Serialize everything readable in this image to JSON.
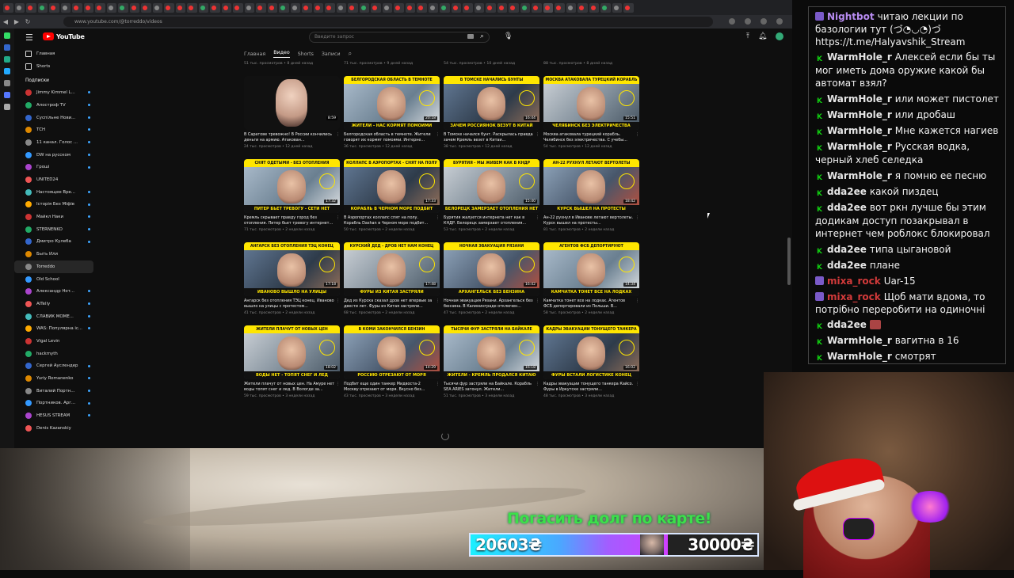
{
  "browser": {
    "url": "www.youtube.com/@torreddo/videos",
    "tab_count": 55
  },
  "youtube": {
    "logo": "YouTube",
    "search_placeholder": "Введите запрос",
    "nav": [
      {
        "label": "Главная"
      },
      {
        "label": "Shorts"
      }
    ],
    "subscriptions_header": "Подписки",
    "subscriptions": [
      {
        "label": "Jimmy Kimmel L...",
        "dot": true
      },
      {
        "label": "Апостроф TV",
        "dot": true
      },
      {
        "label": "Суспільне Нови...",
        "dot": true
      },
      {
        "label": "ТСН",
        "dot": true
      },
      {
        "label": "11 канал. Голос ...",
        "dot": true
      },
      {
        "label": "DW на русском",
        "dot": true
      },
      {
        "label": "Гроші",
        "dot": true
      },
      {
        "label": "UNITED24",
        "dot": false
      },
      {
        "label": "Настоящее Вре...",
        "dot": true
      },
      {
        "label": "Історія Без Міфів",
        "dot": true
      },
      {
        "label": "Майкл Наки",
        "dot": true
      },
      {
        "label": "STERNENKO",
        "dot": true
      },
      {
        "label": "Дмитро Кулеба",
        "dot": true
      },
      {
        "label": "Быть Или",
        "dot": false
      },
      {
        "label": "Torreddo",
        "dot": false,
        "selected": true
      },
      {
        "label": "Old School",
        "dot": false
      },
      {
        "label": "Александр Нот...",
        "dot": true
      },
      {
        "label": "AITelly",
        "dot": true
      },
      {
        "label": "СЛАВИК МОМЕ...",
        "dot": true
      },
      {
        "label": "WAS: Популярна іс...",
        "dot": true
      },
      {
        "label": "Vigal Levin",
        "dot": false
      },
      {
        "label": "hackmyth",
        "dot": false
      },
      {
        "label": "Сергей Ауслендер",
        "dot": true
      },
      {
        "label": "Yuriy Romanenko",
        "dot": true
      },
      {
        "label": "Виталий Портн...",
        "dot": true
      },
      {
        "label": "Портников. Арг...",
        "dot": true
      },
      {
        "label": "HESUS STREAM",
        "dot": true
      },
      {
        "label": "Denis Kazanskiy",
        "dot": false
      }
    ],
    "channel_tabs": [
      {
        "label": "Главная",
        "active": false
      },
      {
        "label": "Видео",
        "active": true
      },
      {
        "label": "Shorts",
        "active": false
      },
      {
        "label": "Записи",
        "active": false
      }
    ],
    "prev_row_meta": [
      "51 тыс. просмотров • 8 дней назад",
      "71 тыс. просмотров • 9 дней назад",
      "54 тыс. просмотров • 10 дней назад",
      "88 тыс. просмотров • 8 дней назад"
    ],
    "rows": [
      [
        {
          "banner": "",
          "caption": "",
          "duration": "8:59",
          "plain": true,
          "title": "В Саратове тревожно! В России кончились деньги на армию. Атакован...",
          "meta": "24 тыс. просмотров • 12 дней назад"
        },
        {
          "banner": "БЕЛГОРОДСКАЯ ОБЛАСТЬ В ТЕМНОТЕ",
          "caption": "ЖИТЕЛИ - НАС КОРМЯТ ПОМОИМИ",
          "duration": "20:18",
          "plain": false,
          "title": "Белгородская область в темноте. Жители говорят их кормят помоями. Интерне...",
          "meta": "36 тыс. просмотров • 12 дней назад"
        },
        {
          "banner": "В ТОМСКЕ НАЧАЛИСЬ БУНТЫ",
          "caption": "ЗАЧЕМ РОССИЯНОК ВЕЗУТ В КИТАЙ",
          "duration": "16:44",
          "plain": false,
          "title": "В Томске начался бунт. Раскрылась правда зачем Кремль везет в Китаи...",
          "meta": "38 тыс. просмотров • 12 дней назад"
        },
        {
          "banner": "МОСКВА АТАКОВАЛА ТУРЕЦКИЙ КОРАБЛЬ",
          "caption": "ЧЕЛЯБИНСК БЕЗ ЭЛЕКТРИЧЕСТВА",
          "duration": "15:51",
          "plain": false,
          "title": "Москва атаковала турецкий корабль. Челябинск без электричества. С учебы...",
          "meta": "54 тыс. просмотров • 12 дней назад"
        }
      ],
      [
        {
          "banner": "СНЯТ ОДЕТЫМИ - БЕЗ ОТОПЛЕНИЯ",
          "caption": "ПИТЕР БЬЕТ ТРЕВОГУ - СЕТИ НЕТ",
          "duration": "17:32",
          "plain": false,
          "title": "Кремль скрывает правду город без отопления. Питер бьет тревогу интернет...",
          "meta": "71 тыс. просмотров • 2 недели назад"
        },
        {
          "banner": "КОЛЛАПС В АЭРОПОРТАХ - СНЯТ НА ПОЛУ",
          "caption": "КОРАБЛЬ В ЧЕРНОМ МОРЕ ПОДБИТ",
          "duration": "17:33",
          "plain": false,
          "title": "В Аэропортах коллапс спят на полу. Корабль Dashan в Черном море подбит...",
          "meta": "50 тыс. просмотров • 2 недели назад"
        },
        {
          "banner": "БУРЯТИЯ - МЫ ЖИВЕМ КАК В КНДР",
          "caption": "БЕЛОРЕЦК ЗАМЕРЗАЕТ ОТОПЛЕНИЯ НЕТ",
          "duration": "15:40",
          "plain": false,
          "title": "Бурятия жалуется интернета нет как в КНДР. Белорецк замерзает отопления...",
          "meta": "53 тыс. просмотров • 2 недели назад"
        },
        {
          "banner": "АН-22 РУХНУЛ ЛЕТАЮТ ВЕРТОЛЕТЫ",
          "caption": "КУРСК ВЫШЕЛ НА ПРОТЕСТЫ",
          "duration": "18:42",
          "plain": false,
          "title": "Ан-22 рухнул в Иванове летают вертолеты. Курск вышел на протесты...",
          "meta": "81 тыс. просмотров • 2 недели назад"
        }
      ],
      [
        {
          "banner": "АНГАРСК БЕЗ ОТОПЛЕНИЯ ТЭЦ КОНЕЦ",
          "caption": "ИВАНОВО ВЫШЛО НА УЛИЦЫ",
          "duration": "17:18",
          "plain": false,
          "title": "Ангарск без отопления ТЭЦ конец. Иваново вышло на улицы с протестом...",
          "meta": "41 тыс. просмотров • 2 недели назад"
        },
        {
          "banner": "КУРСКИЙ ДЕД - ДРОВ НЕТ НАМ КОНЕЦ",
          "caption": "ФУРЫ ИЗ КИТАЯ ЗАСТРЯЛИ",
          "duration": "17:48",
          "plain": false,
          "title": "Дед из Курска сказал дров нет впервые за двести лет. Фуры из Китая застряли...",
          "meta": "68 тыс. просмотров • 2 недели назад"
        },
        {
          "banner": "НОЧНАЯ ЭВАКУАЦИЯ РЯЗАНИ",
          "caption": "АРХАНГЕЛЬСК БЕЗ БЕНЗИНА",
          "duration": "16:42",
          "plain": false,
          "title": "Ночная эвакуация Рязани. Архангельск без бензина. В Калининграде отключен...",
          "meta": "47 тыс. просмотров • 2 недели назад"
        },
        {
          "banner": "АГЕНТОВ ФСБ ДЕПОРТИРУЮТ",
          "caption": "КАМЧАТКА ТОНЕТ ВСЕ НА ЛОДКАХ",
          "duration": "14:34",
          "plain": false,
          "title": "Камчатка тонет все на лодках. Агентов ФСБ депортировали из Польши. В...",
          "meta": "58 тыс. просмотров • 2 недели назад"
        }
      ],
      [
        {
          "banner": "ЖИТЕЛИ ПЛАЧУТ ОТ НОВЫХ ЦЕН",
          "caption": "ВОДЫ НЕТ - ТОПЯТ СНЕГ И ЛЕД",
          "duration": "18:02",
          "plain": false,
          "title": "Жители плачут от новых цен. На Амуре нет воды топят снег и лед. В Вологде за...",
          "meta": "59 тыс. просмотров • 3 недели назад"
        },
        {
          "banner": "В КОМИ ЗАКОНЧИЛСЯ БЕНЗИН",
          "caption": "РОССИЮ ОТРЕЗАЮТ ОТ МОРЯ",
          "duration": "14:29",
          "plain": false,
          "title": "Подбит еще один танкер Мидвоста-2 Москву отрезают от моря. Вкусно без...",
          "meta": "43 тыс. просмотров • 3 недели назад"
        },
        {
          "banner": "ТЫСЯЧИ ФУР ЗАСТРЯЛИ НА БАЙКАЛЕ",
          "caption": "ЖИТЕЛИ - КРЕМЛЬ ПРОДАЛСЯ КИТАЮ",
          "duration": "16:18",
          "plain": false,
          "title": "Тысячи фур застряли на Байкале. Корабль SEA ARIES затонул. Жители...",
          "meta": "51 тыс. просмотров • 3 недели назад"
        },
        {
          "banner": "КАДРЫ ЭВАКУАЦИИ ТОНУЩЕГО ТАНКЕРА",
          "caption": "ФУРЫ ВСТАЛИ ЛОГИСТИКЕ КОНЕЦ",
          "duration": "16:02",
          "plain": false,
          "title": "Кадры эвакуации тонущего танкера Кайсо. Фуры в Иркутске застряли...",
          "meta": "48 тыс. просмотров • 3 недели назад"
        }
      ]
    ]
  },
  "chat": [
    {
      "badge": "",
      "user": "Nightbot",
      "text": "читаю лекции по базологии тут (づ◔◡◔)づ https://t.me/Halyavshik_Stream",
      "color": "#b78bf0"
    },
    {
      "badge": "K",
      "user": "WarmHole_r",
      "text": "Алексей если бы ты мог иметь дома оружие какой бы автомат взял?",
      "color": "#e6e6e6"
    },
    {
      "badge": "K",
      "user": "WarmHole_r",
      "text": "или может пистолет",
      "color": "#e6e6e6"
    },
    {
      "badge": "K",
      "user": "WarmHole_r",
      "text": "или дробаш",
      "color": "#e6e6e6"
    },
    {
      "badge": "K",
      "user": "WarmHole_r",
      "text": "Мне кажется нагиев",
      "color": "#e6e6e6"
    },
    {
      "badge": "K",
      "user": "WarmHole_r",
      "text": "Русская водка, черный хлеб селедка",
      "color": "#e6e6e6"
    },
    {
      "badge": "K",
      "user": "WarmHole_r",
      "text": "я помню ее песню",
      "color": "#e6e6e6"
    },
    {
      "badge": "K",
      "user": "dda2ee",
      "text": "какой пиздец",
      "color": "#e6e6e6"
    },
    {
      "badge": "K",
      "user": "dda2ee",
      "text": "вот ркн лучше бы этим додикам доступ позакрывал в интернет чем роблокс блокировал",
      "color": "#e6e6e6"
    },
    {
      "badge": "K",
      "user": "dda2ee",
      "text": "типа цыгановой",
      "color": "#e6e6e6"
    },
    {
      "badge": "K",
      "user": "dda2ee",
      "text": "плане",
      "color": "#e6e6e6"
    },
    {
      "badge": "",
      "user": "mixa_rock",
      "text": "Uar-15",
      "color": "#d23a3a"
    },
    {
      "badge": "",
      "user": "mixa_rock",
      "text": "Щоб мати вдома, то потрібно переробити на одиночні",
      "color": "#d23a3a"
    },
    {
      "badge": "K",
      "user": "dda2ee",
      "text": "",
      "color": "#e6e6e6"
    },
    {
      "badge": "K",
      "user": "WarmHole_r",
      "text": "вагитна в 16",
      "color": "#e6e6e6"
    },
    {
      "badge": "K",
      "user": "WarmHole_r",
      "text": "смотрят",
      "color": "#e6e6e6"
    }
  ],
  "donation": {
    "title": "Погасить долг по карте!",
    "current": "20603₴",
    "goal": "30000₴",
    "current_value": 20603,
    "goal_value": 30000,
    "accent": "#3ce04a"
  }
}
